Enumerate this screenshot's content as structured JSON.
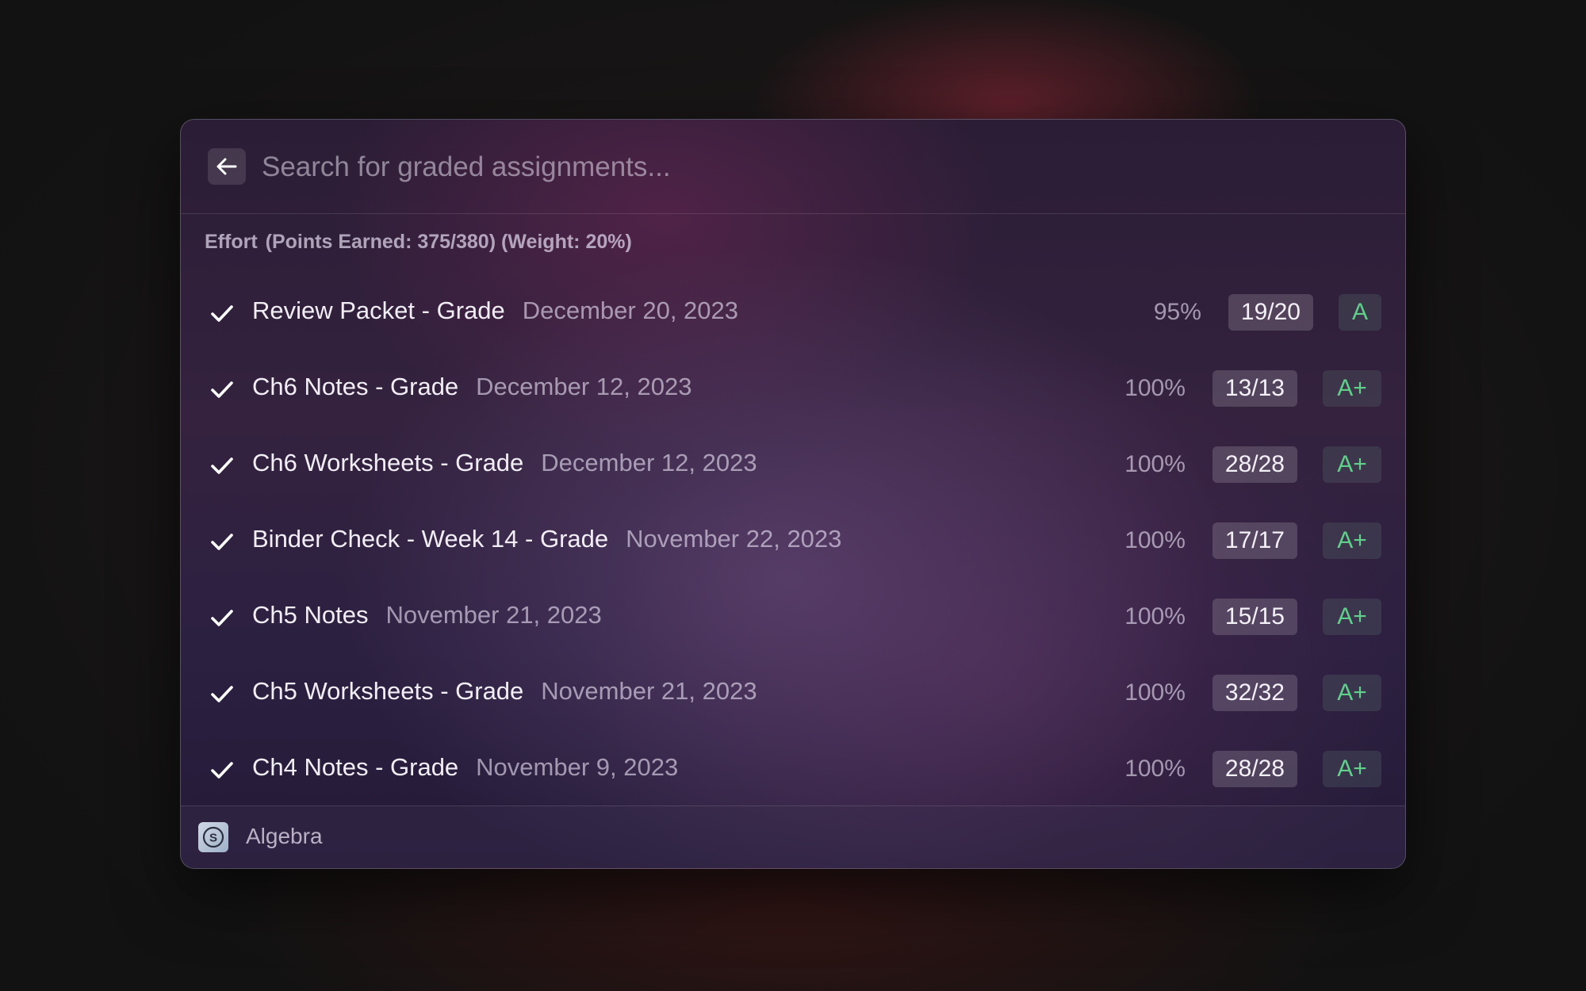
{
  "search": {
    "placeholder": "Search for graded assignments..."
  },
  "section": {
    "category": "Effort",
    "details": "(Points Earned: 375/380) (Weight: 20%)"
  },
  "assignments": [
    {
      "title": "Review Packet - Grade",
      "date": "December 20, 2023",
      "percent": "95%",
      "score": "19/20",
      "grade": "A"
    },
    {
      "title": "Ch6 Notes - Grade",
      "date": "December 12, 2023",
      "percent": "100%",
      "score": "13/13",
      "grade": "A+"
    },
    {
      "title": "Ch6 Worksheets - Grade",
      "date": "December 12, 2023",
      "percent": "100%",
      "score": "28/28",
      "grade": "A+"
    },
    {
      "title": "Binder Check - Week 14 - Grade",
      "date": "November 22, 2023",
      "percent": "100%",
      "score": "17/17",
      "grade": "A+"
    },
    {
      "title": "Ch5 Notes",
      "date": "November 21, 2023",
      "percent": "100%",
      "score": "15/15",
      "grade": "A+"
    },
    {
      "title": "Ch5 Worksheets - Grade",
      "date": "November 21, 2023",
      "percent": "100%",
      "score": "32/32",
      "grade": "A+"
    },
    {
      "title": "Ch4 Notes - Grade",
      "date": "November 9, 2023",
      "percent": "100%",
      "score": "28/28",
      "grade": "A+"
    }
  ],
  "footer": {
    "logo_letter": "S",
    "label": "Algebra"
  },
  "icons": {
    "back": "arrow-left-icon",
    "row_status": "checkmark-icon",
    "footer_logo": "schoology-logo-icon"
  },
  "colors": {
    "grade_green": "#5fcf8a",
    "window_bg": "#2f2140",
    "page_bg": "#161414"
  }
}
